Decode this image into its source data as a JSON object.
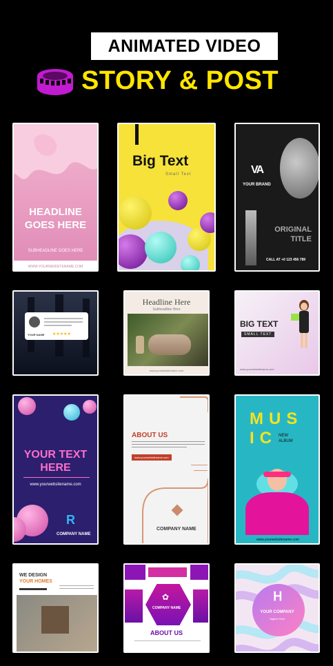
{
  "header": {
    "title": "ANIMATED VIDEO",
    "subtitle": "STORY & POST",
    "icon": "film-reel-icon",
    "accent_color": "#ffe500",
    "icon_color": "#c21ad0"
  },
  "templates": {
    "c1": {
      "headline": "HEADLINE GOES HERE",
      "subheadline": "SUBHEADLINE GOES HERE",
      "website": "WWW.YOURWEBSITENAME.COM"
    },
    "c2": {
      "title": "Big Text",
      "subtitle": "Small Text"
    },
    "c3": {
      "brand": "YOUR BRAND",
      "title": "ORIGINAL TITLE",
      "call": "CALL AT +0 123 456 789"
    },
    "c4": {
      "name": "YOUR NAME",
      "stars": "★★★★★"
    },
    "c5": {
      "title": "Headline Here",
      "subtitle": "Subheadline Here",
      "website": "www.yourwebsitename.com"
    },
    "c6": {
      "title": "BIG TEXT",
      "subtitle": "SMALL TEXT",
      "website": "www.yourwebsitename.com"
    },
    "c7": {
      "title": "YOUR TEXT HERE",
      "website": "www.yourwebsitename.com",
      "company": "COMPANY NAME"
    },
    "c8": {
      "title": "ABOUT US",
      "website": "www.yourwebsitename.com",
      "company": "COMPANY NAME"
    },
    "c9": {
      "title_line1": "MUS",
      "title_line2": "IC",
      "album": "NEW ALBUM",
      "website": "www.yourwebsitename.com"
    },
    "c10": {
      "line1": "WE DESIGN",
      "line2": "YOUR HOMES"
    },
    "c11": {
      "company": "COMPANY NAME",
      "title": "ABOUT US"
    },
    "c12": {
      "company": "YOUR COMPANY",
      "tagline": "Tagline Here"
    }
  }
}
